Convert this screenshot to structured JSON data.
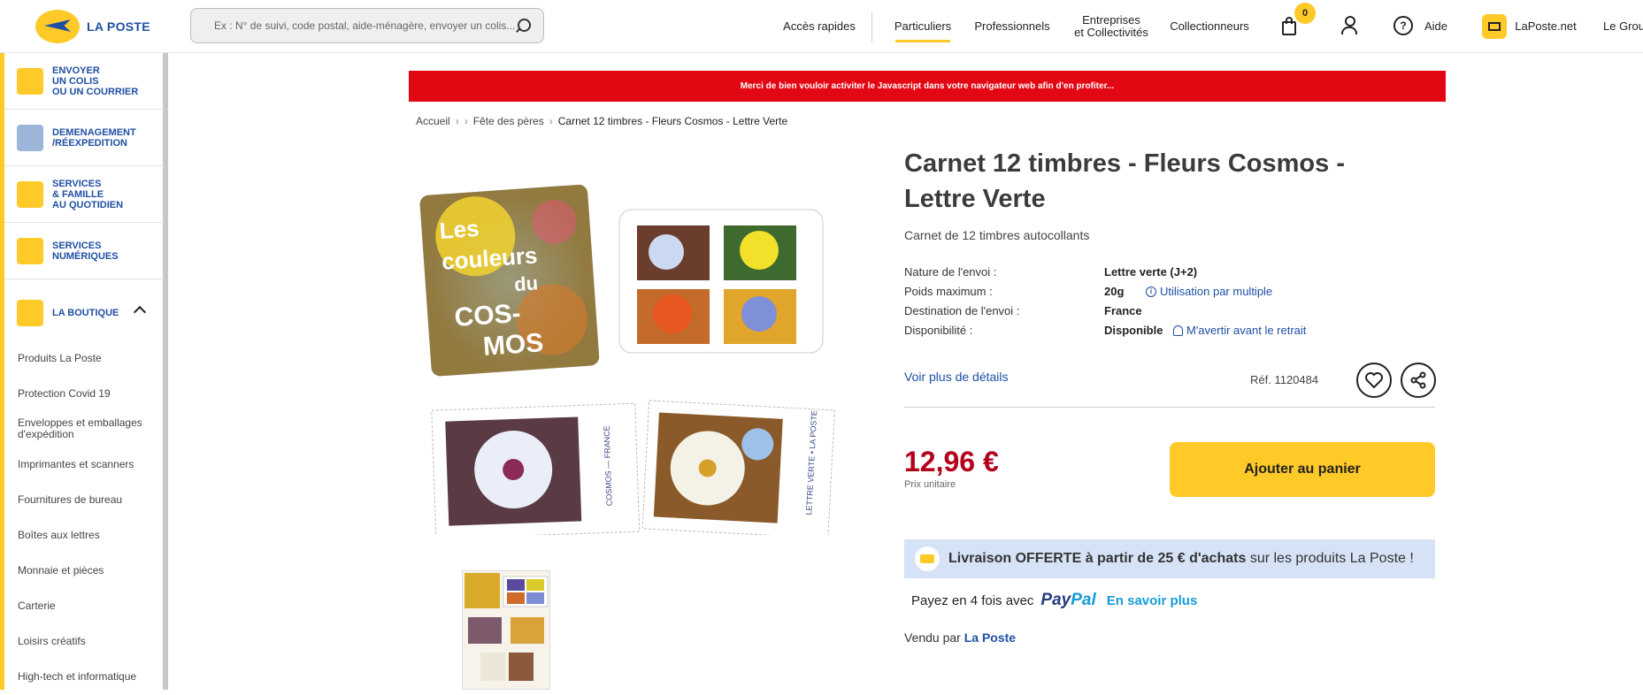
{
  "header": {
    "logo_text": "LA POSTE",
    "search_placeholder": "Ex : N° de suivi, code postal, aide-ménagère, envoyer un colis...",
    "nav": {
      "quick": "Accès rapides",
      "particuliers": "Particuliers",
      "professionnels": "Professionnels",
      "entreprises": "Entreprises\net Collectivités",
      "collectionneurs": "Collectionneurs",
      "aide": "Aide",
      "laposte_net": "LaPoste.net",
      "le_groupe": "Le Grou"
    },
    "cart_count": "0"
  },
  "sidebar": {
    "items": [
      {
        "label": "ENVOYER\nUN COLIS\nOU UN COURRIER",
        "icon": "plane-icon"
      },
      {
        "label": "DEMENAGEMENT\n/RÉEXPEDITION",
        "icon": "box-icon"
      },
      {
        "label": "SERVICES\n& FAMILLE\nAU QUOTIDIEN",
        "icon": "family-icon"
      },
      {
        "label": "SERVICES\nNUMÉRIQUES",
        "icon": "digital-icon"
      },
      {
        "label": "LA BOUTIQUE",
        "icon": "shop-icon"
      }
    ],
    "sub_items": [
      "Produits La Poste",
      "Protection Covid 19",
      "Enveloppes et emballages d'expédition",
      "Imprimantes et scanners",
      "Fournitures de bureau",
      "Boîtes aux lettres",
      "Monnaie et pièces",
      "Carterie",
      "Loisirs créatifs",
      "High-tech et informatique"
    ]
  },
  "banner": "Merci de bien vouloir activiter le Javascript dans votre navigateur web afin d'en profiter...",
  "breadcrumb": {
    "home": "Accueil",
    "parent": "Fête des pères",
    "current": "Carnet 12 timbres - Fleurs Cosmos - Lettre Verte"
  },
  "product": {
    "title": "Carnet 12 timbres - Fleurs Cosmos - Lettre Verte",
    "subtitle": "Carnet de 12 timbres autocollants",
    "specs": [
      {
        "label": "Nature de l'envoi :",
        "value": "Lettre verte (J+2)"
      },
      {
        "label": "Poids maximum :",
        "value": "20g"
      },
      {
        "label": "Destination de l'envoi :",
        "value": "France"
      },
      {
        "label": "Disponibilité :",
        "value": "Disponible"
      }
    ],
    "multiple_link": "Utilisation par multiple",
    "notify_link": "M'avertir avant le retrait",
    "details_link": "Voir plus de détails",
    "ref": "Réf. 1120484",
    "price": "12,96 €",
    "price_unit": "Prix unitaire",
    "add_to_cart": "Ajouter au panier",
    "delivery_bold": "Livraison OFFERTE à partir de 25 € d'achats",
    "delivery_rest": "sur les produits La Poste !",
    "paypal_text": "Payez en 4 fois avec",
    "paypal_logo_a": "Pay",
    "paypal_logo_b": "Pal",
    "paypal_more": "En savoir plus",
    "sold_by_text": "Vendu par",
    "sold_by_link": "La Poste",
    "cover_text": "Les couleurs du COS-MOS",
    "stamp_caption": "COSMOS — FRANCE",
    "stamp_sub": "LETTRE VERTE • LA POSTE"
  },
  "colors": {
    "brand_yellow": "#ffc928",
    "brand_blue": "#1f4fa3",
    "price_red": "#b3001b",
    "banner_red": "#e30613"
  }
}
